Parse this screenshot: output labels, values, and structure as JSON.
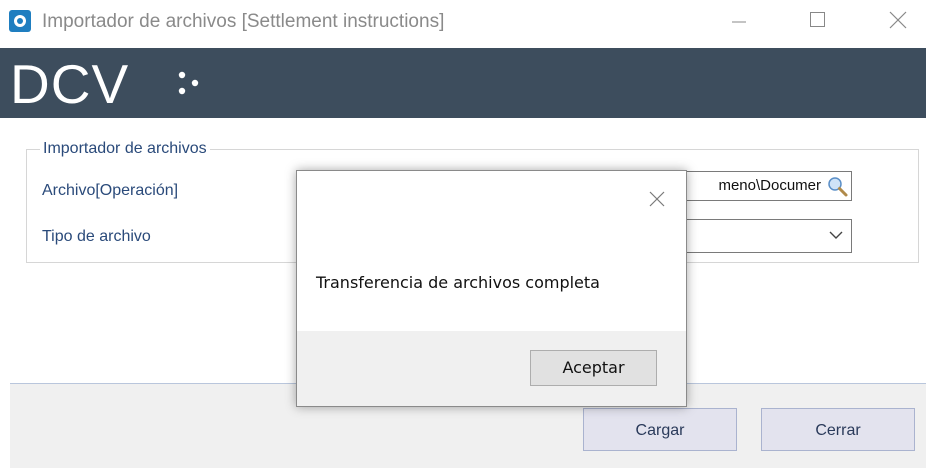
{
  "window": {
    "title": "Importador de archivos [Settlement instructions]",
    "icon": "app-icon",
    "controls": [
      "minimize-icon",
      "maximize-icon",
      "close-icon"
    ]
  },
  "banner": {
    "logo_text": "DCV",
    "background_color": "#3d4d5d"
  },
  "form": {
    "group_title": "Importador de archivos",
    "archivo_label": "Archivo[Operación]",
    "archivo_value": "meno\\Documer",
    "archivo_button_icon": "search-icon",
    "tipo_label": "Tipo de archivo",
    "tipo_value": ""
  },
  "footer": {
    "cargar_label": "Cargar",
    "cerrar_label": "Cerrar"
  },
  "dialog": {
    "message": "Transferencia de archivos completa",
    "accept_label": "Aceptar"
  }
}
